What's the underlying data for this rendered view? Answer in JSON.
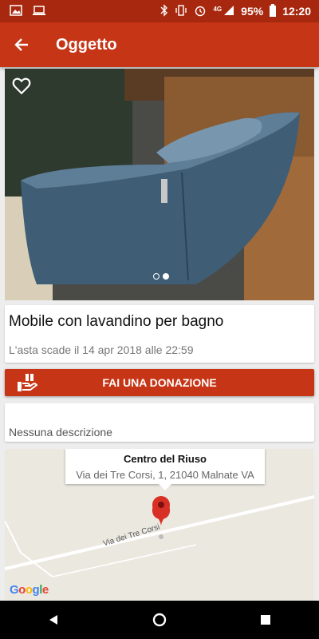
{
  "status_bar": {
    "battery": "95%",
    "time": "12:20",
    "network": "4G"
  },
  "app_bar": {
    "title": "Oggetto",
    "back_icon": "arrow-back-icon"
  },
  "item": {
    "title": "Mobile con lavandino per bagno",
    "expiry": "L'asta scade il 14 apr 2018 alle 22:59",
    "favorite_icon": "heart-outline-icon",
    "photo_count": 2,
    "active_photo_index": 1
  },
  "donate_button": {
    "label": "FAI UNA DONAZIONE",
    "icon": "donate-hand-icon"
  },
  "description": {
    "text": "Nessuna descrizione"
  },
  "map": {
    "place_name": "Centro del Riuso",
    "address": "Via dei Tre Corsi, 1, 21040 Malnate VA",
    "street_label": "Via dei Tre Corsi",
    "attribution": "Google",
    "marker_icon": "map-pin-icon"
  },
  "colors": {
    "primary": "#c63515",
    "status_bar": "#a8280f",
    "marker": "#d93025"
  }
}
